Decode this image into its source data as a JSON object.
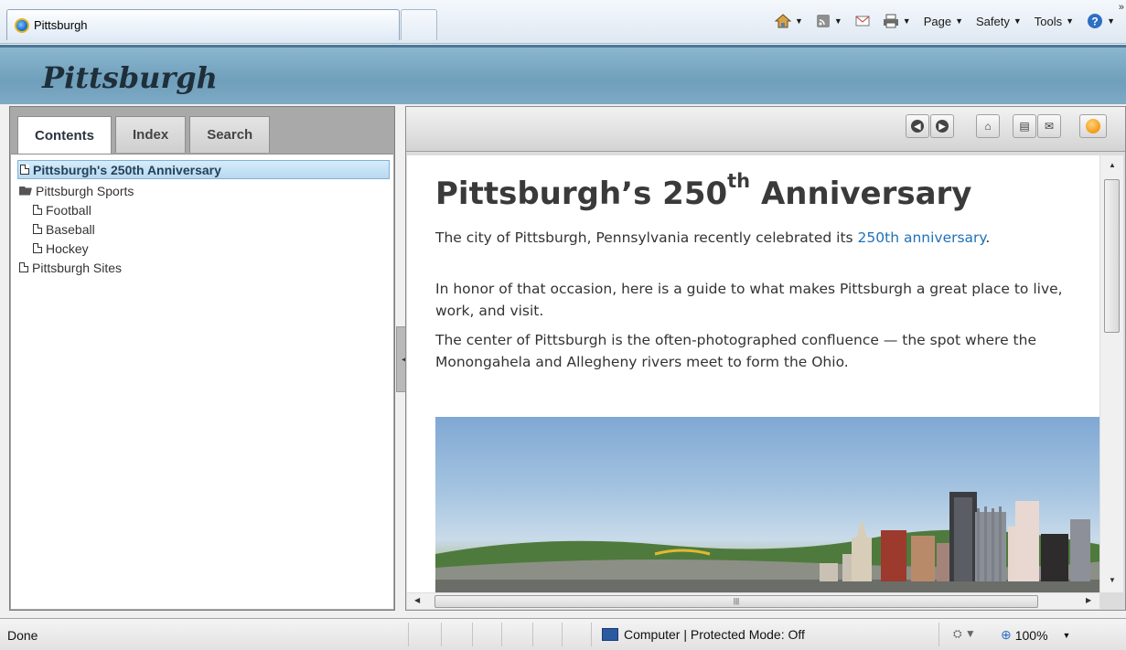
{
  "browser": {
    "tab_title": "Pittsburgh",
    "commands": {
      "page": "Page",
      "safety": "Safety",
      "tools": "Tools"
    }
  },
  "help": {
    "title": "Pittsburgh",
    "tabs": [
      "Contents",
      "Index",
      "Search"
    ],
    "active_tab": "Contents",
    "tree": [
      {
        "label": "Pittsburgh's 250th Anniversary",
        "type": "page",
        "selected": true
      },
      {
        "label": "Pittsburgh Sports",
        "type": "folder-open"
      },
      {
        "label": "Football",
        "type": "page",
        "child": true
      },
      {
        "label": "Baseball",
        "type": "page",
        "child": true
      },
      {
        "label": "Hockey",
        "type": "page",
        "child": true
      },
      {
        "label": "Pittsburgh Sites",
        "type": "page"
      }
    ]
  },
  "article": {
    "heading_main": "Pittsburgh’s 250",
    "heading_sup": "th",
    "heading_tail": " Anniversary",
    "p1_before": "The city of Pittsburgh, Pennsylvania recently celebrated its ",
    "p1_link": "250th anniversary",
    "p1_after": ".",
    "p2": "In honor of that occasion, here is a guide to what makes Pittsburgh a great place to live, work, and visit.",
    "p3": "The center of Pittsburgh is the often-photographed confluence — the spot where the Monongahela and Allegheny rivers meet to form the Ohio."
  },
  "status": {
    "left": "Done",
    "zone": "Computer | Protected Mode: Off",
    "zoom": "100%"
  },
  "colors": {
    "header_bg": "#7eaac5",
    "link": "#1e72b8",
    "selection": "#b8d9f0"
  }
}
